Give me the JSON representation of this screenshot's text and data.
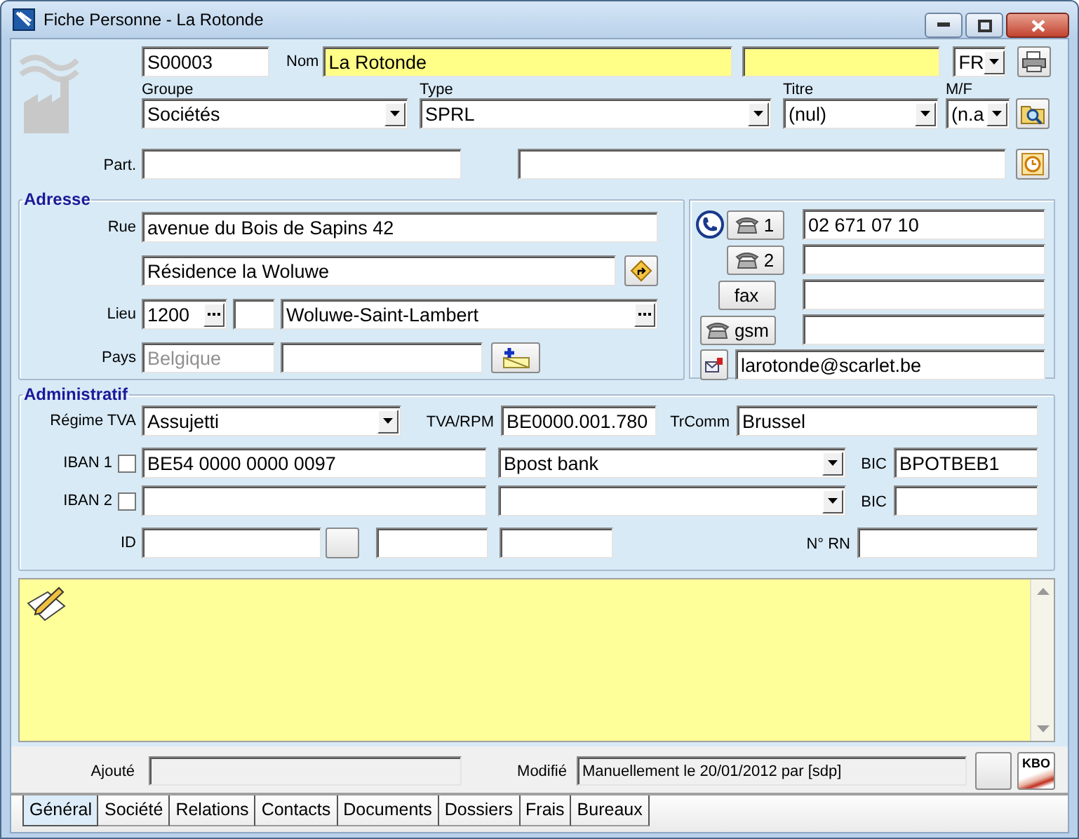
{
  "window": {
    "title": "Fiche Personne - La Rotonde"
  },
  "header": {
    "code": "S00003",
    "nom_label": "Nom",
    "nom": "La Rotonde",
    "language": "FR",
    "selects": [
      {
        "label": "Groupe",
        "value": "Sociétés"
      },
      {
        "label": "Type",
        "value": "SPRL"
      },
      {
        "label": "Titre",
        "value": "(nul)"
      },
      {
        "label": "M/F",
        "value": "(n.a"
      }
    ],
    "part_label": "Part."
  },
  "adresse": {
    "title": "Adresse",
    "rue_label": "Rue",
    "rue": "avenue du Bois de Sapins 42",
    "rue2": "Résidence la Woluwe",
    "lieu_label": "Lieu",
    "postcode": "1200",
    "city": "Woluwe-Saint-Lambert",
    "pays_label": "Pays",
    "country": "Belgique",
    "country_disabled": true
  },
  "contacts": [
    {
      "kind": "phone",
      "label": "1",
      "value": "02 671 07 10"
    },
    {
      "kind": "phone",
      "label": "2"
    },
    {
      "kind": "plain",
      "label": "fax"
    },
    {
      "kind": "phone",
      "label": "gsm"
    },
    {
      "kind": "email",
      "value": "larotonde@scarlet.be"
    }
  ],
  "administratif": {
    "title": "Administratif",
    "regime_label": "Régime TVA",
    "regime": "Assujetti",
    "tva_label": "TVA/RPM",
    "tva": "BE0000.001.780",
    "trcomm_label": "TrComm",
    "trcomm": "Brussel",
    "ibans": [
      {
        "label": "IBAN 1",
        "checked": false,
        "iban": "BE54 0000 0000 0097",
        "bank": "Bpost bank",
        "bic_label": "BIC",
        "bic": "BPOTBEB1"
      },
      {
        "label": "IBAN 2",
        "checked": false,
        "bic_label": "BIC"
      }
    ],
    "id_label": "ID",
    "rn_label": "N° RN"
  },
  "footer": {
    "ajoute_label": "Ajouté",
    "modifie_label": "Modifié",
    "modifie": "Manuellement le 20/01/2012 par [sdp]",
    "kbo": "KBO"
  },
  "tabs": [
    {
      "label": "Général",
      "selected": true
    },
    {
      "label": "Société",
      "selected": false
    },
    {
      "label": "Relations",
      "selected": false
    },
    {
      "label": "Contacts",
      "selected": false
    },
    {
      "label": "Documents",
      "selected": false
    },
    {
      "label": "Dossiers",
      "selected": false
    },
    {
      "label": "Frais",
      "selected": false
    },
    {
      "label": "Bureaux",
      "selected": false
    }
  ]
}
